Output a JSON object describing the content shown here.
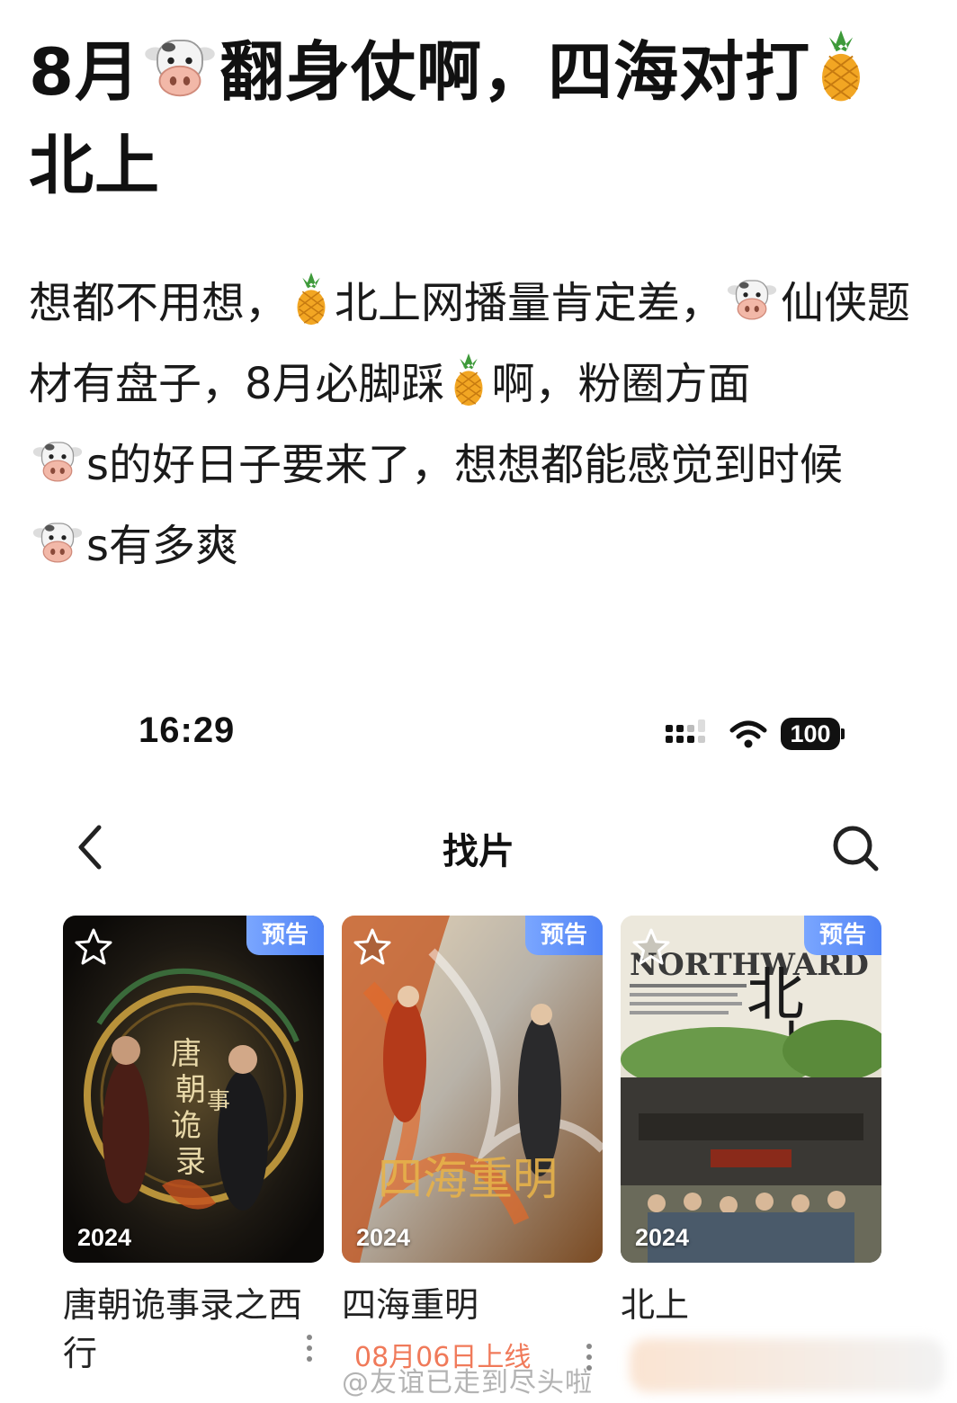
{
  "post": {
    "title_part1": "8月",
    "title_part2": "翻身仗啊，四海对打",
    "title_part3": "北上",
    "body_part1": "想都不用想，",
    "body_part2": "北上网播量肯定差，",
    "body_part3": "仙侠题材有盘子，8月必脚踩",
    "body_part4": "啊，粉圈方面",
    "body_part5": "s的好日子要来了，想想都能感觉到时候",
    "body_part6": "s有多爽",
    "emoji": {
      "cow": "cow-face-emoji",
      "pineapple": "pineapple-emoji"
    }
  },
  "phone": {
    "status_bar": {
      "time": "16:29",
      "battery": "100"
    },
    "nav": {
      "title": "找片"
    },
    "cards": [
      {
        "badge": "预告",
        "year": "2024",
        "title": "唐朝诡事录之西行",
        "accent": "#8a6a2a"
      },
      {
        "badge": "预告",
        "year": "2024",
        "title": "四海重明",
        "date": "08月06日上线",
        "accent": "#c9502e"
      },
      {
        "badge": "预告",
        "year": "2024",
        "title": "北上",
        "accent": "#4d6b3a"
      }
    ],
    "watermark": "@友谊已走到尽头啦"
  }
}
